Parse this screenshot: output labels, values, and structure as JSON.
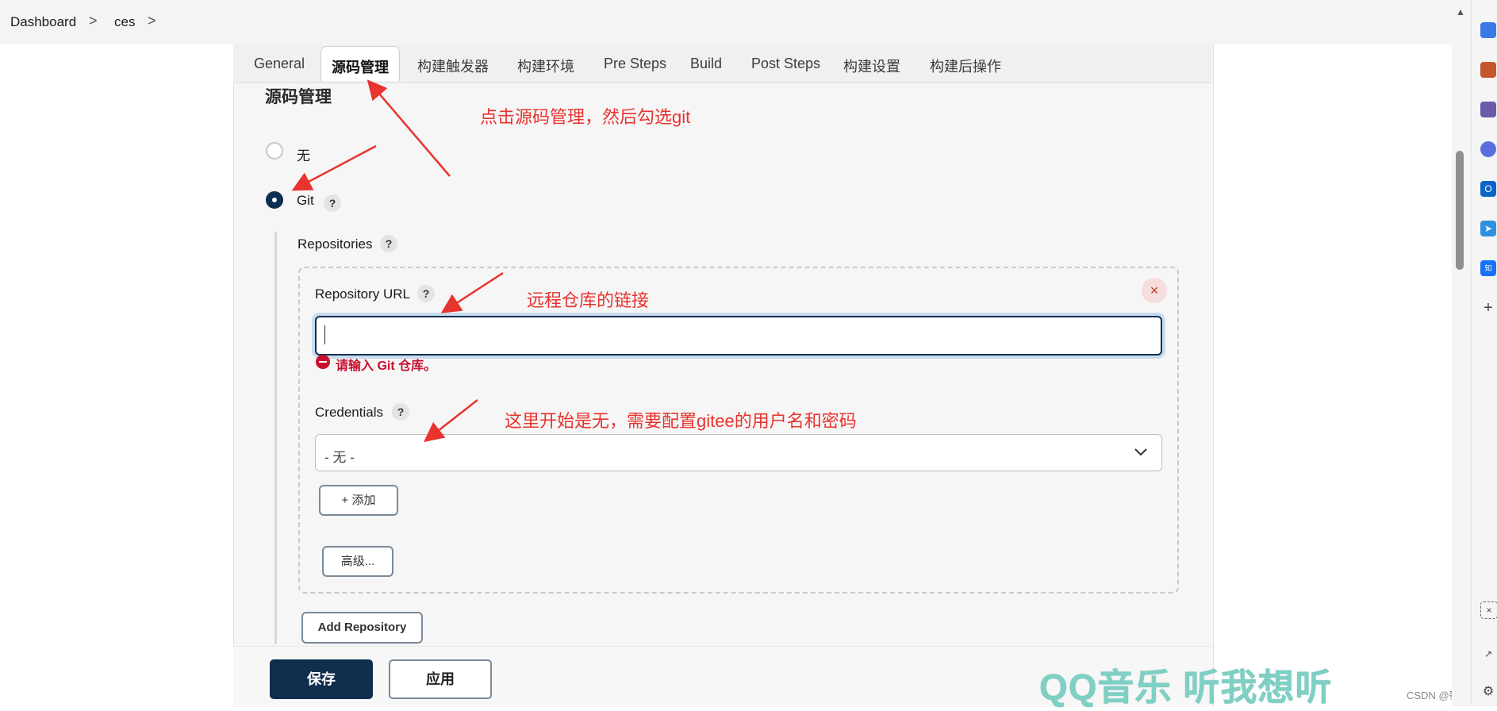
{
  "breadcrumb": {
    "items": [
      "Dashboard",
      "ces"
    ],
    "separator": ">"
  },
  "tabs": [
    {
      "label": "General",
      "active": false
    },
    {
      "label": "源码管理",
      "active": true
    },
    {
      "label": "构建触发器",
      "active": false
    },
    {
      "label": "构建环境",
      "active": false
    },
    {
      "label": "Pre Steps",
      "active": false
    },
    {
      "label": "Build",
      "active": false
    },
    {
      "label": "Post Steps",
      "active": false
    },
    {
      "label": "构建设置",
      "active": false
    },
    {
      "label": "构建后操作",
      "active": false
    }
  ],
  "scm": {
    "title": "源码管理",
    "options": [
      {
        "label": "无",
        "selected": false
      },
      {
        "label": "Git",
        "selected": true
      }
    ],
    "help_glyph": "?",
    "repositories_label": "Repositories",
    "repository_url_label": "Repository URL",
    "repository_url_value": "",
    "error_message": "请输入 Git 仓库。",
    "credentials_label": "Credentials",
    "credentials_selected": "- 无 -",
    "add_button": "+ 添加",
    "advanced_button": "高级...",
    "add_repository_button": "Add Repository",
    "close_glyph": "×"
  },
  "footer": {
    "save": "保存",
    "apply": "应用"
  },
  "annotations": {
    "tab_hint": "点击源码管理，然后勾选git",
    "url_hint": "远程仓库的链接",
    "credentials_hint": "这里开始是无，需要配置gitee的用户名和密码"
  },
  "watermark": "QQ音乐 听我想听",
  "csdn_mark": "CSDN @瓠飞鸣",
  "edge_icons": [
    "tag-icon",
    "briefcase-icon",
    "people-icon",
    "copilot-icon",
    "outlook-icon",
    "send-icon",
    "zhihu-icon",
    "plus-icon",
    "screenshot-icon",
    "external-link-icon",
    "settings-icon"
  ],
  "colors": {
    "primary": "#0f2d4c",
    "error": "#c8102e",
    "annotation": "#e8332e",
    "watermark": "#7fd0c4"
  }
}
